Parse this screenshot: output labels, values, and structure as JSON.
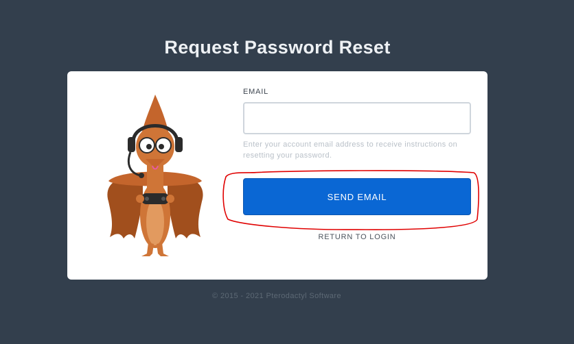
{
  "page": {
    "title": "Request Password Reset"
  },
  "form": {
    "email_label": "EMAIL",
    "email_value": "",
    "help_text": "Enter your account email address to receive instructions on resetting your password.",
    "send_label": "SEND EMAIL",
    "return_label": "RETURN TO LOGIN"
  },
  "footer": {
    "copyright": "© 2015 - 2021 Pterodactyl Software"
  },
  "colors": {
    "background": "#333f4d",
    "card": "#ffffff",
    "accent": "#0a67d4",
    "annotation": "#e00000"
  },
  "icons": {
    "mascot": "pterodactyl-mascot-icon"
  }
}
